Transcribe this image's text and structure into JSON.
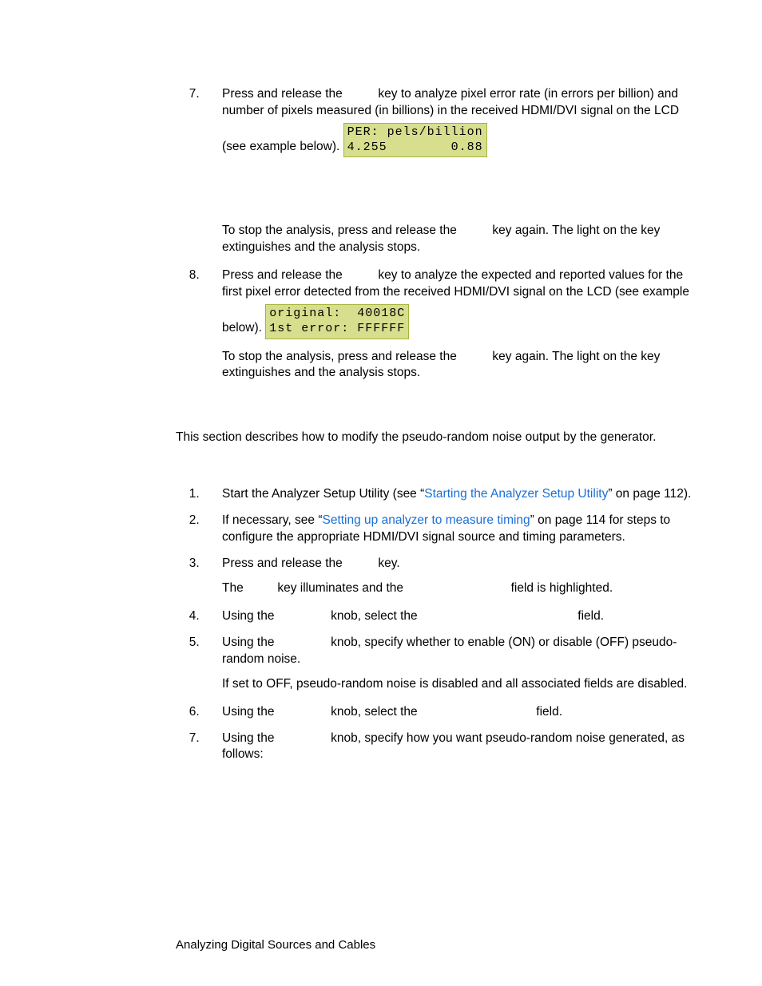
{
  "step7": {
    "text_a": "Press and release the ",
    "text_b": " key to analyze pixel error rate (in errors per billion) and number of pixels measured (in billions) in the received HDMI/DVI signal on the LCD (see example below).",
    "lcd_line1": "PER: pels/billion",
    "lcd_line2": "4.255        0.88",
    "stop_a": "To stop the analysis, press and release the ",
    "stop_b": " key again. The light on the key extinguishes and the analysis stops."
  },
  "step8": {
    "text_a": "Press and release the ",
    "text_b": " key to analyze the expected and reported values for the first pixel error detected from the received HDMI/DVI signal on the LCD (see example below).",
    "lcd_line1": "original:  40018C",
    "lcd_line2": "1st error: FFFFFF",
    "stop_a": "To stop the analysis, press and release the ",
    "stop_b": " key again. The light on the key extinguishes and the analysis stops."
  },
  "section_intro": "This section describes how to modify the pseudo-random noise output by the generator.",
  "s1": {
    "a": "Start the Analyzer Setup Utility (see “",
    "link": "Starting the Analyzer Setup Utility",
    "b": "” on page 112)."
  },
  "s2": {
    "a": "If necessary, see “",
    "link": "Setting up analyzer to measure timing",
    "b": "” on page 114 for steps to configure the appropriate HDMI/DVI signal source and timing parameters."
  },
  "s3": {
    "line1a": "Press and release the ",
    "line1b": " key.",
    "line2a": "The ",
    "line2b": " key illuminates and the ",
    "line2c": " field is highlighted."
  },
  "s4": {
    "a": "Using the ",
    "b": " knob, select the ",
    "c": " field."
  },
  "s5": {
    "a": "Using the ",
    "b": " knob, specify whether to enable (ON) or disable (OFF) pseudo-random noise.",
    "c": "If set to OFF, pseudo-random noise is disabled and all associated fields are disabled."
  },
  "s6": {
    "a": "Using the ",
    "b": " knob, select the ",
    "c": " field."
  },
  "s7": {
    "a": "Using the ",
    "b": " knob, specify how you want pseudo-random noise generated, as follows:"
  },
  "footer": "Analyzing Digital Sources and Cables"
}
